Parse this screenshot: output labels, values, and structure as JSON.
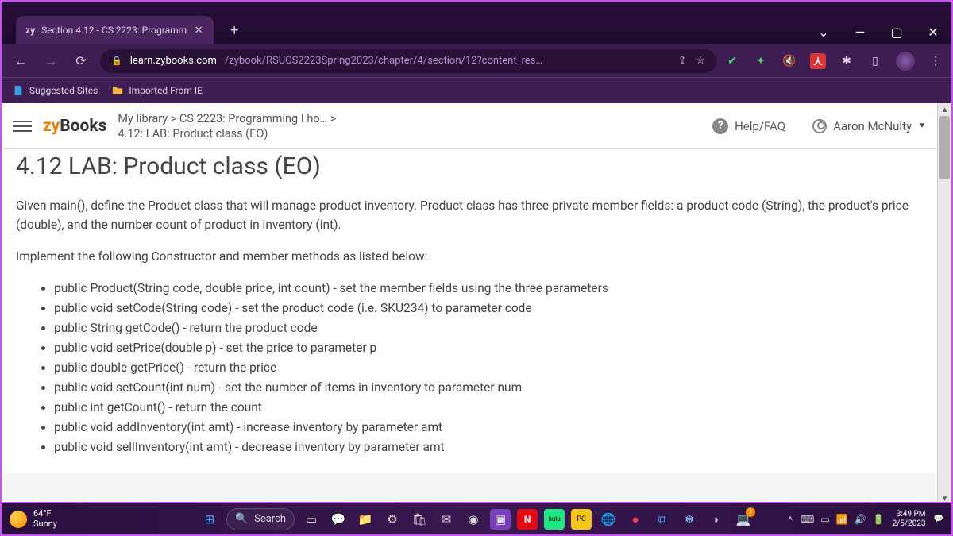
{
  "titlebar": {
    "tab_prefix": "zy",
    "tab_title": "Section 4.12 - CS 2223: Programm"
  },
  "url": {
    "domain": "learn.zybooks.com",
    "path": "/zybook/RSUCS2223Spring2023/chapter/4/section/12?content_res…"
  },
  "bookmarks": {
    "suggested": "Suggested Sites",
    "imported": "Imported From IE"
  },
  "zyheader": {
    "logo_zy": "zy",
    "logo_books": "Books",
    "breadcrumb_top": "My library > CS 2223: Programming I ho…   >",
    "breadcrumb_sub": "4.12: LAB: Product class (EO)",
    "help": "Help/FAQ",
    "user": "Aaron McNulty"
  },
  "content": {
    "title": "4.12 LAB: Product class (EO)",
    "para1": "Given main(), define the Product class that will manage product inventory. Product class has three private member fields: a product code (String), the product's price (double), and the number count of product in inventory (int).",
    "para2": "Implement the following Constructor and member methods as listed below:",
    "methods": [
      "public Product(String code, double price, int count) - set the member fields using the three parameters",
      "public void setCode(String code) - set the product code (i.e. SKU234) to parameter code",
      "public String getCode() - return the product code",
      "public void setPrice(double p) - set the price to parameter p",
      "public double getPrice() - return the price",
      "public void setCount(int num) - set the number of items in inventory to parameter num",
      "public int getCount() - return the count",
      "public void addInventory(int amt) - increase inventory by parameter amt",
      "public void sellInventory(int amt) - decrease inventory by parameter amt"
    ]
  },
  "taskbar": {
    "temp": "64°F",
    "cond": "Sunny",
    "search": "Search",
    "time": "3:49 PM",
    "date": "2/5/2023"
  }
}
